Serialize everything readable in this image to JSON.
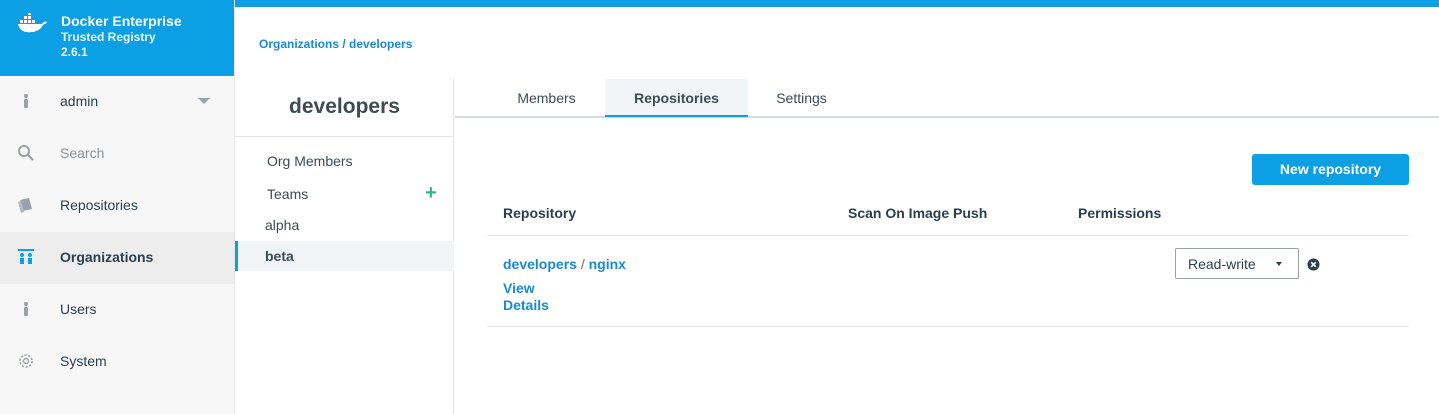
{
  "brand": {
    "title": "Docker Enterprise",
    "subtitle": "Trusted Registry",
    "version": "2.6.1",
    "color": "#0c9fe4"
  },
  "sidebar": {
    "items": [
      {
        "label": "admin",
        "icon": "user-icon"
      },
      {
        "label": "Search",
        "icon": "search-icon"
      },
      {
        "label": "Repositories",
        "icon": "repositories-icon"
      },
      {
        "label": "Organizations",
        "icon": "organizations-icon",
        "active": true
      },
      {
        "label": "Users",
        "icon": "user-icon"
      },
      {
        "label": "System",
        "icon": "gear-icon"
      }
    ]
  },
  "breadcrumb": "Organizations / developers",
  "org": {
    "name": "developers",
    "members_link": "Org Members",
    "teams_label": "Teams",
    "teams": [
      "alpha",
      "beta"
    ],
    "selected_team": "beta"
  },
  "tabs": [
    {
      "label": "Members"
    },
    {
      "label": "Repositories",
      "active": true
    },
    {
      "label": "Settings"
    }
  ],
  "actions": {
    "new_repository": "New repository"
  },
  "table": {
    "headers": [
      "Repository",
      "Scan On Image Push",
      "Permissions"
    ],
    "rows": [
      {
        "namespace": "developers",
        "separator": "/",
        "name": "nginx",
        "view": "View",
        "details": "Details",
        "permission": "Read-write"
      }
    ]
  },
  "colors": {
    "accent": "#0c9fe4",
    "link": "#1a8ad0",
    "add": "#2dbb7f"
  }
}
